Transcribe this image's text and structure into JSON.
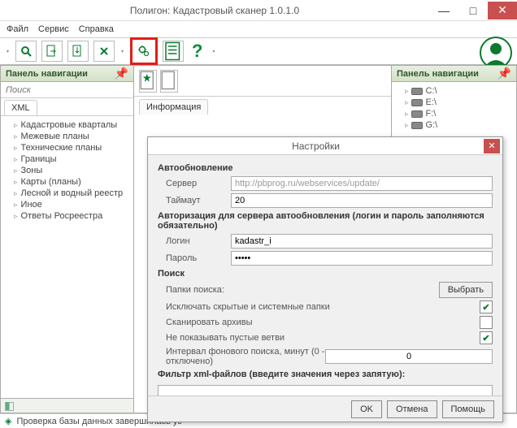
{
  "window": {
    "title": "Полигон: Кадастровый сканер 1.0.1.0",
    "min": "—",
    "max": "□",
    "close": "✕"
  },
  "menu": {
    "file": "Файл",
    "service": "Сервис",
    "help": "Справка"
  },
  "toolbar": {
    "question": "?"
  },
  "left_panel": {
    "title": "Панель навигации",
    "search_ph": "Поиск",
    "tab": "XML",
    "items": [
      "Кадастровые кварталы",
      "Межевые планы",
      "Технические планы",
      "Границы",
      "Зоны",
      "Карты  (планы)",
      "Лесной и водный реестр",
      "Иное",
      "Ответы Росреестра"
    ]
  },
  "center": {
    "info_tab": "Информация"
  },
  "right_panel": {
    "title": "Панель навигации",
    "drives": [
      "C:\\",
      "E:\\",
      "F:\\",
      "G:\\"
    ]
  },
  "status": {
    "text": "Проверка базы данных завершилась ус"
  },
  "dialog": {
    "title": "Настройки",
    "autoupdate": {
      "heading": "Автообновление",
      "server_l": "Сервер",
      "server_v": "http://pbprog.ru/webservices/update/",
      "timeout_l": "Таймаут",
      "timeout_v": "20",
      "auth_text": "Авторизация для сервера автообновления (логин и пароль заполняются обязательно)",
      "login_l": "Логин",
      "login_v": "kadastr_i",
      "pass_l": "Пароль",
      "pass_v": "•••••"
    },
    "search": {
      "heading": "Поиск",
      "folders_l": "Папки поиска:",
      "choose_btn": "Выбрать",
      "opt1": "Исключать скрытые и системные папки",
      "opt2": "Сканировать архивы",
      "opt3": "Не показывать пустые ветви",
      "interval_l": "Интервал фонового поиска, минут (0 - отключено)",
      "interval_v": "0"
    },
    "filter": {
      "heading": "Фильтр xml-файлов (введите значения  через запятую):",
      "value": ""
    },
    "buttons": {
      "ok": "OK",
      "cancel": "Отмена",
      "help": "Помощь"
    }
  }
}
